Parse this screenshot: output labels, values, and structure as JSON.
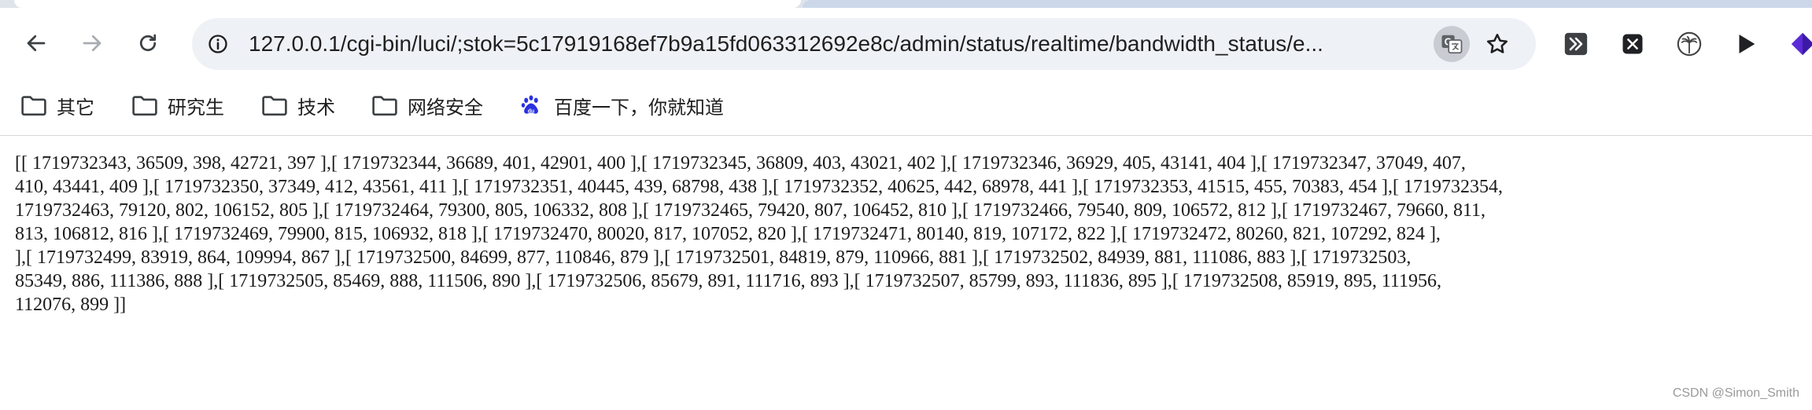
{
  "browser": {
    "url": "127.0.0.1/cgi-bin/luci/;stok=5c17919168ef7b9a15fd063312692e8c/admin/status/realtime/bandwidth_status/e...",
    "icons": {
      "back": "arrow-left-icon",
      "forward": "arrow-right-icon",
      "reload": "reload-icon",
      "site_info": "tune-icon",
      "translate": "translate-icon",
      "bookmark_star": "star-icon"
    },
    "extensions": [
      {
        "name": "terminal-extension-icon",
        "color": "#3c4043"
      },
      {
        "name": "x-extension-icon",
        "color": "#202124"
      },
      {
        "name": "palm-tree-extension-icon",
        "color": "#444444"
      },
      {
        "name": "play-extension-icon",
        "color": "#202124"
      },
      {
        "name": "diamond-extension-icon",
        "color": "#5b2bd6"
      }
    ]
  },
  "bookmarks": [
    {
      "label": "其它",
      "icon": "folder-icon"
    },
    {
      "label": "研究生",
      "icon": "folder-icon"
    },
    {
      "label": "技术",
      "icon": "folder-icon"
    },
    {
      "label": "网络安全",
      "icon": "folder-icon"
    },
    {
      "label": "百度一下，你就知道",
      "icon": "baidu-paw-icon"
    }
  ],
  "content": {
    "lines": [
      "[[ 1719732343,  36509,  398,  42721,  397 ],[ 1719732344,  36689,  401,  42901,  400 ],[ 1719732345,  36809,  403,  43021,  402 ],[ 1719732346,  36929,  405,  43141,  404 ],[ 1719732347,  37049,  407,",
      "410,  43441,  409 ],[ 1719732350,  37349,  412,  43561,  411 ],[ 1719732351,  40445,  439,  68798,  438 ],[ 1719732352,  40625,  442,  68978,  441 ],[ 1719732353,  41515,  455,  70383,  454 ],[ 1719732354,",
      "1719732463,  79120,  802,  106152,  805 ],[ 1719732464,  79300,  805,  106332,  808 ],[ 1719732465,  79420,  807,  106452,  810 ],[ 1719732466,  79540,  809,  106572,  812 ],[ 1719732467,  79660,  811,",
      "813,  106812,  816 ],[ 1719732469,  79900,  815,  106932,  818 ],[ 1719732470,  80020,  817,  107052,  820 ],[ 1719732471,  80140,  819,  107172,  822 ],[ 1719732472,  80260,  821,  107292,  824 ],",
      "],[ 1719732499,  83919,  864,  109994,  867 ],[ 1719732500,  84699,  877,  110846,  879 ],[ 1719732501,  84819,  879,  110966,  881 ],[ 1719732502,  84939,  881,  111086,  883 ],[ 1719732503,",
      "85349,  886,  111386,  888 ],[ 1719732505,  85469,  888,  111506,  890 ],[ 1719732506,  85679,  891,  111716,  893 ],[ 1719732507,  85799,  893,  111836,  895 ],[ 1719732508,  85919,  895,  111956,",
      "112076,  899 ]]"
    ]
  },
  "watermark": "CSDN @Simon_Smith"
}
